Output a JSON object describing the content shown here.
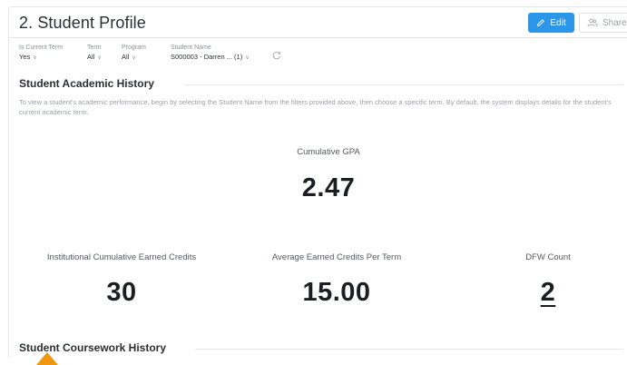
{
  "header": {
    "title": "2. Student Profile",
    "edit_label": "Edit",
    "share_label": "Share",
    "edit_icon": "pencil-icon",
    "share_icon": "people-icon"
  },
  "filters": [
    {
      "label": "Is Current Term",
      "value": "Yes"
    },
    {
      "label": "Term",
      "value": "All"
    },
    {
      "label": "Program",
      "value": "All"
    },
    {
      "label": "Student Name",
      "value": "S000003 - Darren ... (1)"
    }
  ],
  "academic_history": {
    "title": "Student Academic History",
    "description": "To view a student's academic performance, begin by selecting the Student Name from the filters provided above, then choose a specific term. By default, the system displays details for the student's current academic term.",
    "gpa": {
      "label": "Cumulative GPA",
      "value": "2.47"
    },
    "credits": {
      "label": "Institutional Cumulative Earned Credits",
      "value": "30"
    },
    "avg_credits": {
      "label": "Average Earned Credits Per Term",
      "value": "15.00"
    },
    "dfw": {
      "label": "DFW Count",
      "value": "2"
    }
  },
  "coursework": {
    "title": "Student Coursework History"
  },
  "colors": {
    "accent": "#2c96e8",
    "cursor": "#f0960f"
  }
}
